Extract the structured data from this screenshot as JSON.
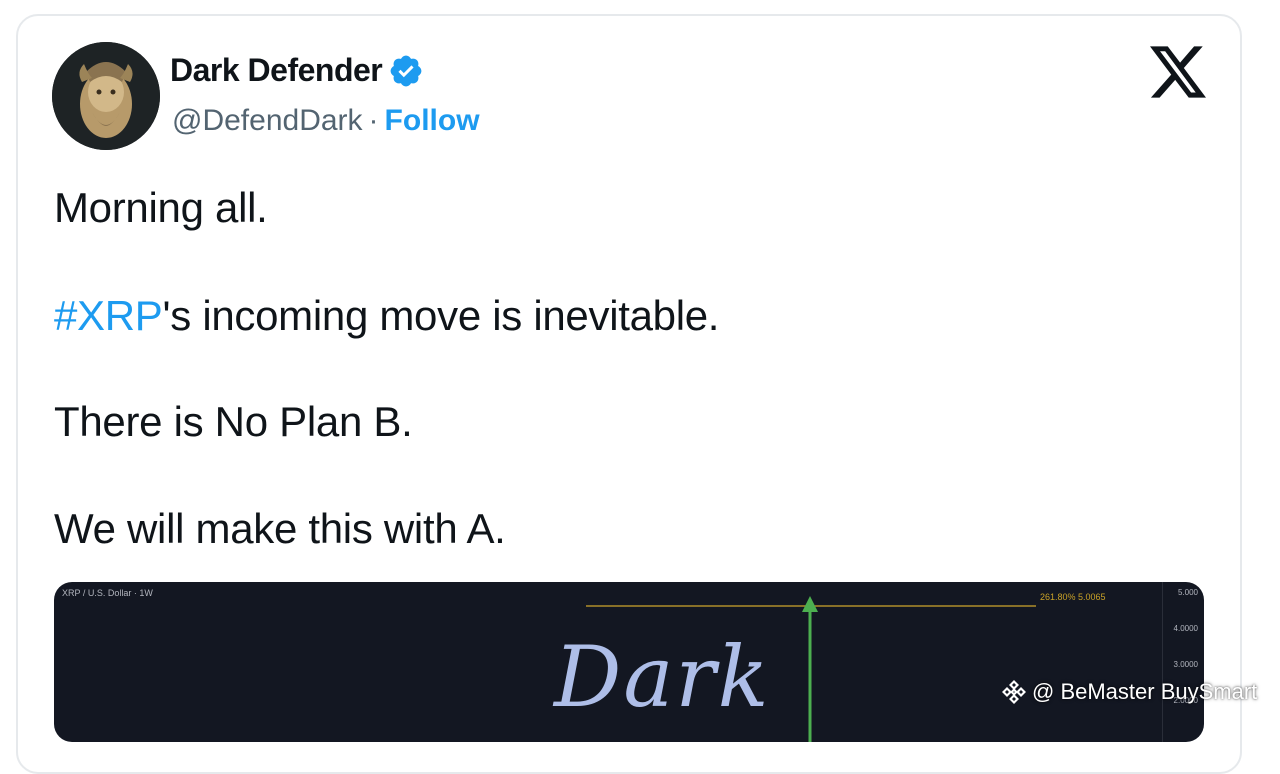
{
  "tweet": {
    "author": {
      "display_name": "Dark Defender",
      "handle": "@DefendDark",
      "separator": "·",
      "follow_label": "Follow",
      "verified": true
    },
    "lines": {
      "line1": "Morning all.",
      "line2_hashtag": "#XRP",
      "line2_rest": "'s incoming move is inevitable.",
      "line3": "There is No Plan B.",
      "line4": "We will make this with A."
    },
    "media": {
      "chart_title": "XRP / U.S. Dollar · 1W",
      "price_label": "261.80% 5.0065",
      "axis_ticks": [
        "5.000",
        "4.0000",
        "3.0000",
        "2.0000"
      ],
      "overlay_text": "Dark"
    }
  },
  "watermark": {
    "text": "@ BeMaster BuySmart"
  },
  "colors": {
    "accent": "#1d9bf0",
    "text": "#0f1419",
    "muted": "#536471",
    "chart_bg": "#131722",
    "arrow": "#4caf50"
  },
  "icons": {
    "verified": "verified-badge-icon",
    "platform": "x-logo-icon",
    "watermark": "binance-icon"
  }
}
